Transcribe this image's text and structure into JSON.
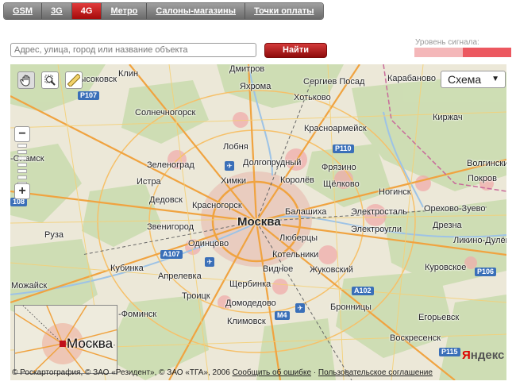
{
  "tabs": [
    {
      "label": "GSM",
      "active": false
    },
    {
      "label": "3G",
      "active": false
    },
    {
      "label": "4G",
      "active": true
    },
    {
      "label": "Метро",
      "active": false
    },
    {
      "label": "Салоны-магазины",
      "active": false
    },
    {
      "label": "Точки оплаты",
      "active": false
    }
  ],
  "search": {
    "placeholder": "Адрес, улица, город или название объекта",
    "button_label": "Найти"
  },
  "signal": {
    "label": "Уровень сигнала:",
    "colors": [
      "#f4b7b9",
      "#ec5860"
    ]
  },
  "map": {
    "tools": [
      "hand-icon",
      "magnifier-icon",
      "ruler-icon"
    ],
    "scheme_label": "Схема",
    "scheme_caret": "▼",
    "zoom_in_label": "+",
    "zoom_out_label": "−",
    "cities": [
      {
        "name": "Клин"
      },
      {
        "name": "Дмитров"
      },
      {
        "name": "Карабаново"
      },
      {
        "name": "Яхрома"
      },
      {
        "name": "Сергиев Посад"
      },
      {
        "name": "Хотьково"
      },
      {
        "name": "Солнечногорск"
      },
      {
        "name": "Киржач"
      },
      {
        "name": "Красноармейск"
      },
      {
        "name": "Лобня"
      },
      {
        "name": "Зеленоград"
      },
      {
        "name": "Долгопрудный"
      },
      {
        "name": "Фрязино"
      },
      {
        "name": "Истра"
      },
      {
        "name": "Химки"
      },
      {
        "name": "Королёв"
      },
      {
        "name": "Щёлково"
      },
      {
        "name": "Покров"
      },
      {
        "name": "Волгинский"
      },
      {
        "name": "Дедовск"
      },
      {
        "name": "Ногинск"
      },
      {
        "name": "Орехово-Зуево"
      },
      {
        "name": "Красногорск"
      },
      {
        "name": "Балашиха"
      },
      {
        "name": "Электросталь"
      },
      {
        "name": "Москва",
        "big": true
      },
      {
        "name": "Звенигород"
      },
      {
        "name": "Электроугли"
      },
      {
        "name": "Дрезна"
      },
      {
        "name": "Руза"
      },
      {
        "name": "Одинцово"
      },
      {
        "name": "Люберцы"
      },
      {
        "name": "Ликино-Дулёво"
      },
      {
        "name": "Котельники"
      },
      {
        "name": "Кубинка"
      },
      {
        "name": "Видное"
      },
      {
        "name": "Жуковский"
      },
      {
        "name": "Куровское"
      },
      {
        "name": "Апрелевка"
      },
      {
        "name": "Можайск"
      },
      {
        "name": "Щербинка"
      },
      {
        "name": "Троицк"
      },
      {
        "name": "Домодедово"
      },
      {
        "name": "Бронницы"
      },
      {
        "name": "Климовск"
      },
      {
        "name": "Егорьевск"
      },
      {
        "name": "Воскресенск"
      },
      {
        "name": "-Фоминск"
      },
      {
        "name": "Высоковск"
      },
      {
        "name": "-Оламск"
      }
    ],
    "roads": [
      "Р107",
      "Р110",
      "А107",
      "А102",
      "М4",
      "Р106",
      "Р115",
      "108"
    ],
    "minimap_label": "Москва",
    "copyright": "© Роскартография, © ЗАО «Резидент», © ЗАО «ТГА», 2006",
    "report_link": "Сообщить об ошибке",
    "separator": " · ",
    "agreement_link": "Пользовательское соглашение",
    "logo_first": "Я",
    "logo_rest": "ндекс"
  }
}
